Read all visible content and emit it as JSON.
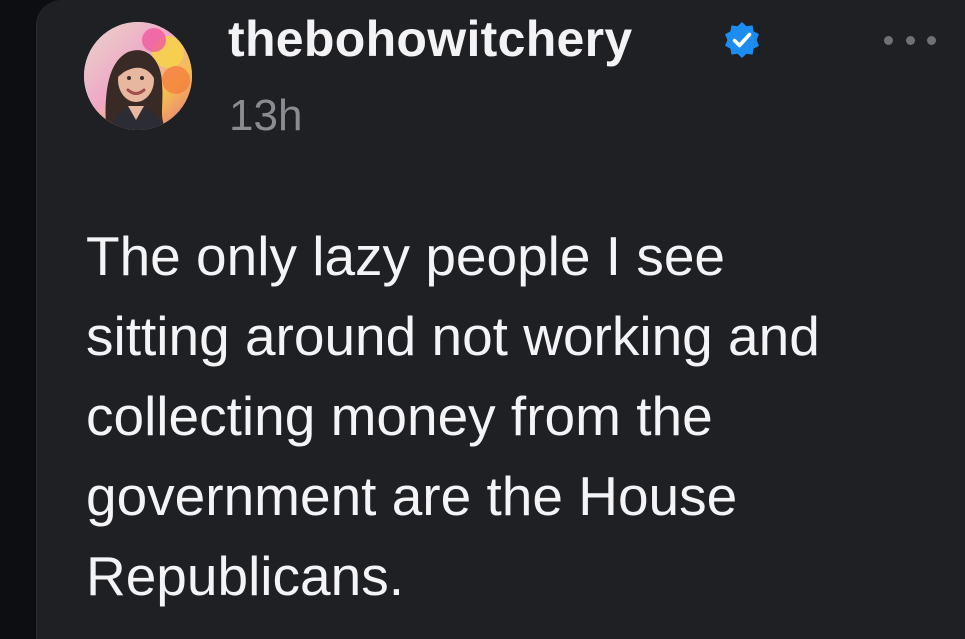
{
  "post": {
    "username": "thebohowitchery",
    "verified": true,
    "timestamp": "13h",
    "more_icon": "more-horizontal-icon",
    "avatar_icon": "profile-photo",
    "body_lines": [
      "The only lazy people I see",
      "sitting around not working and",
      "collecting money from the",
      "government are the House",
      "Republicans."
    ]
  },
  "colors": {
    "background": "#0d0e11",
    "card": "#1f2024",
    "text": "#f4f4f6",
    "muted": "#8a8c92",
    "verified_badge": "#1d8cf0"
  }
}
